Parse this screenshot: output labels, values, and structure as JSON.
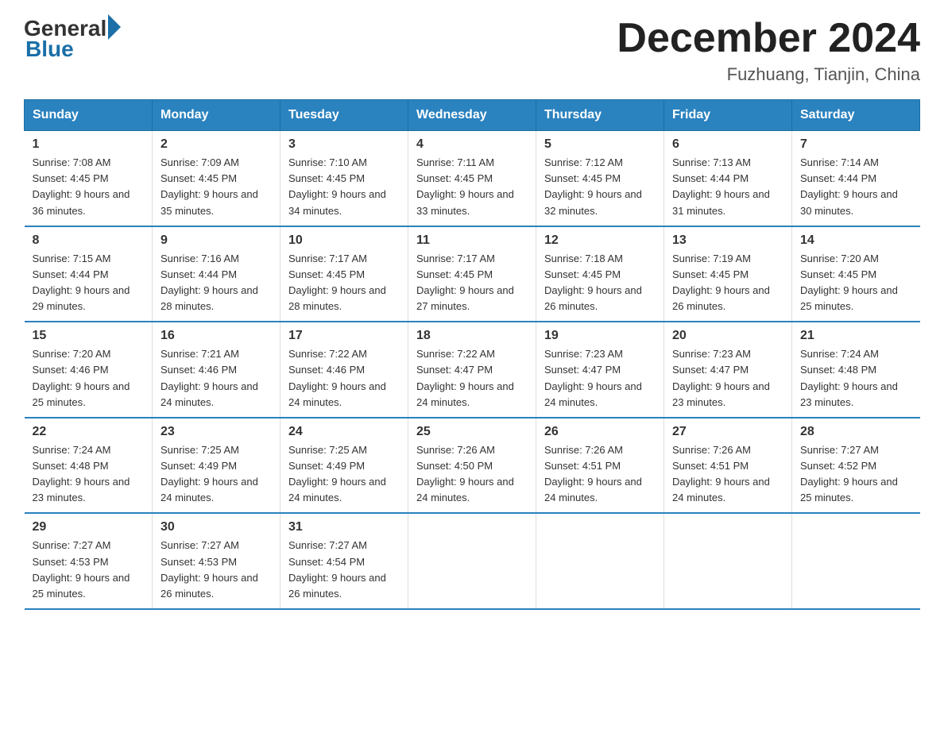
{
  "logo": {
    "general": "General",
    "blue": "Blue"
  },
  "title": {
    "month_year": "December 2024",
    "location": "Fuzhuang, Tianjin, China"
  },
  "days_of_week": [
    "Sunday",
    "Monday",
    "Tuesday",
    "Wednesday",
    "Thursday",
    "Friday",
    "Saturday"
  ],
  "weeks": [
    [
      {
        "day": "1",
        "sunrise": "7:08 AM",
        "sunset": "4:45 PM",
        "daylight": "9 hours and 36 minutes."
      },
      {
        "day": "2",
        "sunrise": "7:09 AM",
        "sunset": "4:45 PM",
        "daylight": "9 hours and 35 minutes."
      },
      {
        "day": "3",
        "sunrise": "7:10 AM",
        "sunset": "4:45 PM",
        "daylight": "9 hours and 34 minutes."
      },
      {
        "day": "4",
        "sunrise": "7:11 AM",
        "sunset": "4:45 PM",
        "daylight": "9 hours and 33 minutes."
      },
      {
        "day": "5",
        "sunrise": "7:12 AM",
        "sunset": "4:45 PM",
        "daylight": "9 hours and 32 minutes."
      },
      {
        "day": "6",
        "sunrise": "7:13 AM",
        "sunset": "4:44 PM",
        "daylight": "9 hours and 31 minutes."
      },
      {
        "day": "7",
        "sunrise": "7:14 AM",
        "sunset": "4:44 PM",
        "daylight": "9 hours and 30 minutes."
      }
    ],
    [
      {
        "day": "8",
        "sunrise": "7:15 AM",
        "sunset": "4:44 PM",
        "daylight": "9 hours and 29 minutes."
      },
      {
        "day": "9",
        "sunrise": "7:16 AM",
        "sunset": "4:44 PM",
        "daylight": "9 hours and 28 minutes."
      },
      {
        "day": "10",
        "sunrise": "7:17 AM",
        "sunset": "4:45 PM",
        "daylight": "9 hours and 28 minutes."
      },
      {
        "day": "11",
        "sunrise": "7:17 AM",
        "sunset": "4:45 PM",
        "daylight": "9 hours and 27 minutes."
      },
      {
        "day": "12",
        "sunrise": "7:18 AM",
        "sunset": "4:45 PM",
        "daylight": "9 hours and 26 minutes."
      },
      {
        "day": "13",
        "sunrise": "7:19 AM",
        "sunset": "4:45 PM",
        "daylight": "9 hours and 26 minutes."
      },
      {
        "day": "14",
        "sunrise": "7:20 AM",
        "sunset": "4:45 PM",
        "daylight": "9 hours and 25 minutes."
      }
    ],
    [
      {
        "day": "15",
        "sunrise": "7:20 AM",
        "sunset": "4:46 PM",
        "daylight": "9 hours and 25 minutes."
      },
      {
        "day": "16",
        "sunrise": "7:21 AM",
        "sunset": "4:46 PM",
        "daylight": "9 hours and 24 minutes."
      },
      {
        "day": "17",
        "sunrise": "7:22 AM",
        "sunset": "4:46 PM",
        "daylight": "9 hours and 24 minutes."
      },
      {
        "day": "18",
        "sunrise": "7:22 AM",
        "sunset": "4:47 PM",
        "daylight": "9 hours and 24 minutes."
      },
      {
        "day": "19",
        "sunrise": "7:23 AM",
        "sunset": "4:47 PM",
        "daylight": "9 hours and 24 minutes."
      },
      {
        "day": "20",
        "sunrise": "7:23 AM",
        "sunset": "4:47 PM",
        "daylight": "9 hours and 23 minutes."
      },
      {
        "day": "21",
        "sunrise": "7:24 AM",
        "sunset": "4:48 PM",
        "daylight": "9 hours and 23 minutes."
      }
    ],
    [
      {
        "day": "22",
        "sunrise": "7:24 AM",
        "sunset": "4:48 PM",
        "daylight": "9 hours and 23 minutes."
      },
      {
        "day": "23",
        "sunrise": "7:25 AM",
        "sunset": "4:49 PM",
        "daylight": "9 hours and 24 minutes."
      },
      {
        "day": "24",
        "sunrise": "7:25 AM",
        "sunset": "4:49 PM",
        "daylight": "9 hours and 24 minutes."
      },
      {
        "day": "25",
        "sunrise": "7:26 AM",
        "sunset": "4:50 PM",
        "daylight": "9 hours and 24 minutes."
      },
      {
        "day": "26",
        "sunrise": "7:26 AM",
        "sunset": "4:51 PM",
        "daylight": "9 hours and 24 minutes."
      },
      {
        "day": "27",
        "sunrise": "7:26 AM",
        "sunset": "4:51 PM",
        "daylight": "9 hours and 24 minutes."
      },
      {
        "day": "28",
        "sunrise": "7:27 AM",
        "sunset": "4:52 PM",
        "daylight": "9 hours and 25 minutes."
      }
    ],
    [
      {
        "day": "29",
        "sunrise": "7:27 AM",
        "sunset": "4:53 PM",
        "daylight": "9 hours and 25 minutes."
      },
      {
        "day": "30",
        "sunrise": "7:27 AM",
        "sunset": "4:53 PM",
        "daylight": "9 hours and 26 minutes."
      },
      {
        "day": "31",
        "sunrise": "7:27 AM",
        "sunset": "4:54 PM",
        "daylight": "9 hours and 26 minutes."
      },
      null,
      null,
      null,
      null
    ]
  ]
}
